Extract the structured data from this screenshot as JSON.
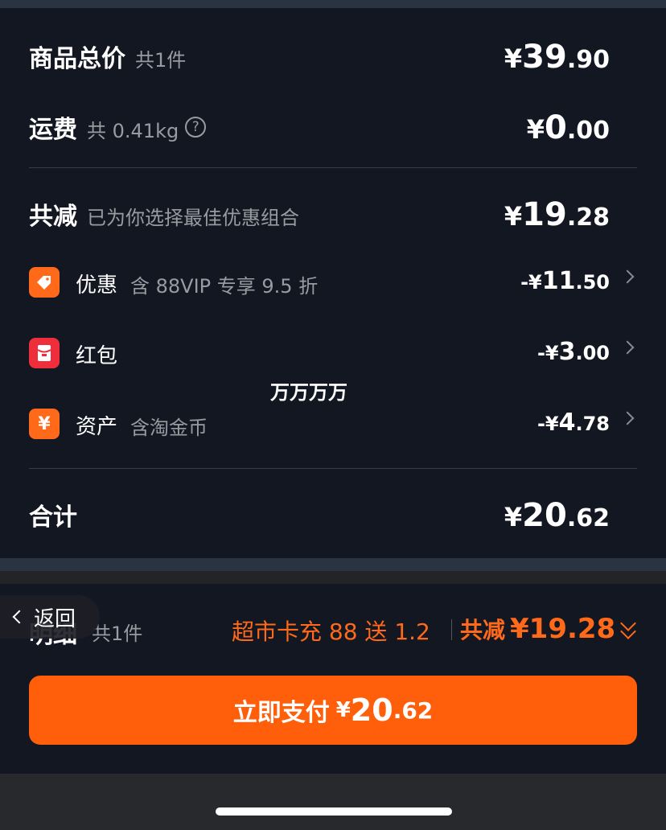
{
  "colors": {
    "background": "#131722",
    "accent": "#ff5e0a",
    "accent_text": "#ff6a1a",
    "muted_text": "#9a9ba0"
  },
  "summary": {
    "goods": {
      "label": "商品总价",
      "sub": "共1件",
      "currency": "¥",
      "int": "39",
      "dec": ".90"
    },
    "shipping": {
      "label": "运费",
      "sub": "共 0.41kg",
      "help": "?",
      "currency": "¥",
      "int": "0",
      "dec": ".00"
    },
    "reduce": {
      "label": "共减",
      "sub": "已为你选择最佳优惠组合",
      "currency": "¥",
      "int": "19",
      "dec": ".28"
    },
    "total": {
      "label": "合计",
      "currency": "¥",
      "int": "20",
      "dec": ".62"
    }
  },
  "discounts": [
    {
      "icon": "coupon-tag-icon",
      "name": "优惠",
      "desc": "含 88VIP 专享 9.5 折",
      "currency": "-¥",
      "int": "11",
      "dec": ".50"
    },
    {
      "icon": "red-packet-icon",
      "name": "红包",
      "desc": "",
      "currency": "-¥",
      "int": "3",
      "dec": ".00"
    },
    {
      "icon": "yuan-asset-icon",
      "name": "资产",
      "desc": "含淘金币",
      "currency": "-¥",
      "int": "4",
      "dec": ".78"
    }
  ],
  "overlay_text": "万万万万",
  "back": {
    "label": "返回"
  },
  "detail": {
    "label": "明细",
    "sub": "共1件",
    "promo": "超市卡充 88 送 1.2",
    "reduce_label": "共减",
    "reduce_value": "¥19.28"
  },
  "pay": {
    "label": "立即支付",
    "currency": "¥",
    "int": "20",
    "dec": ".62"
  }
}
